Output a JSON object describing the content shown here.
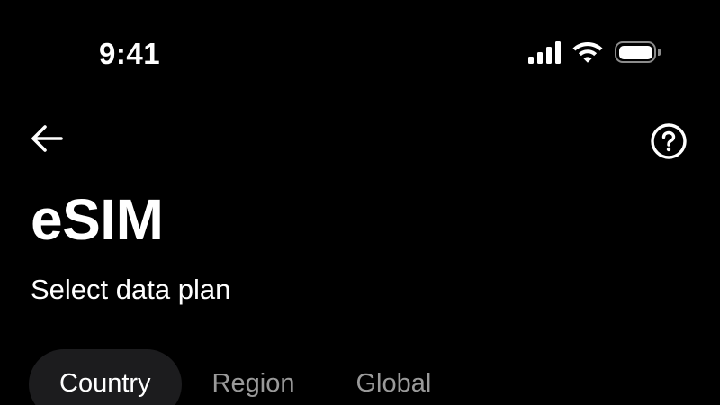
{
  "status_bar": {
    "time": "9:41",
    "icons": [
      "cellular-signal-icon",
      "wifi-icon",
      "battery-icon"
    ]
  },
  "nav": {
    "back_icon": "arrow-left-icon",
    "help_icon": "question-circle-icon"
  },
  "header": {
    "title": "eSIM",
    "subtitle": "Select data plan"
  },
  "tabs": [
    {
      "label": "Country",
      "active": true
    },
    {
      "label": "Region",
      "active": false
    },
    {
      "label": "Global",
      "active": false
    }
  ],
  "colors": {
    "background": "#000000",
    "text": "#ffffff",
    "tab_inactive": "#9a9a9a",
    "tab_active_bg": "#1c1c1e"
  }
}
